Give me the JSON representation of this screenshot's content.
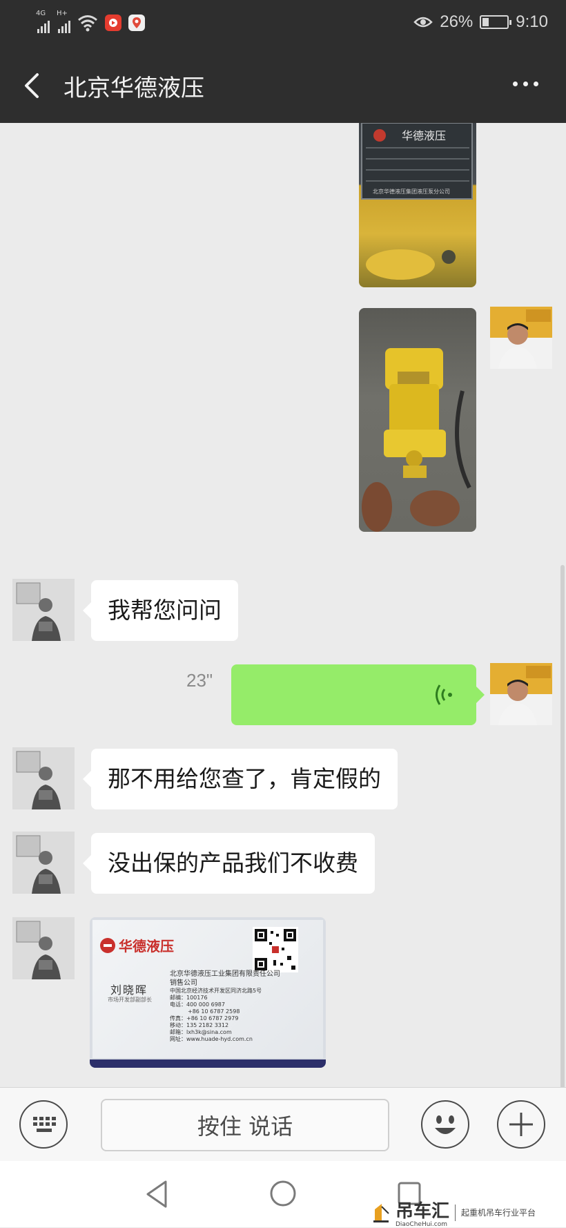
{
  "status_bar": {
    "network_1": "4G",
    "network_2": "H+",
    "battery_percent": "26%",
    "battery_level": 0.26,
    "time": "9:10"
  },
  "header": {
    "title": "北京华德液压"
  },
  "messages": [
    {
      "side": "right",
      "kind": "image",
      "description": "nameplate-photo",
      "visible_text": [
        "华德液压",
        "北京华德液压集团液压泵分公司"
      ]
    },
    {
      "side": "right",
      "kind": "image",
      "description": "hydraulic-pump-photo"
    },
    {
      "side": "left",
      "kind": "text",
      "text": "我帮您问问"
    },
    {
      "side": "right",
      "kind": "voice",
      "duration": "23\""
    },
    {
      "side": "left",
      "kind": "text",
      "text": "那不用给您查了，肯定假的"
    },
    {
      "side": "left",
      "kind": "text",
      "text": "没出保的产品我们不收费"
    },
    {
      "side": "left",
      "kind": "image",
      "description": "business-card-photo"
    }
  ],
  "business_card": {
    "brand": "华德液压",
    "name": "刘晓晖",
    "position": "市场开发部副部长",
    "company": "北京华德液压工业集团有限责任公司",
    "division": "销售公司",
    "address": "中国北京经济技术开发区同济北路5号",
    "postcode": "邮编：100176",
    "phone": "电话：400 000 6987",
    "phone2": "+86 10 6787 2598",
    "fax": "传真：+86 10 6787 2979",
    "mobile": "移动：135 2182 3312",
    "email": "邮箱：lxh3k@sina.com",
    "website": "网址：www.huade-hyd.com.cn"
  },
  "nameplate": {
    "brand": "华德液压",
    "maker": "北京华德液压集团液压泵分公司"
  },
  "input_bar": {
    "hold_to_talk": "按住 说话"
  },
  "watermark": {
    "name": "吊车汇",
    "url": "DiaoCheHui.com",
    "tagline": "起重机吊车行业平台"
  },
  "colors": {
    "header_bg": "#2e2e2e",
    "chat_bg": "#ebebeb",
    "bubble_sent": "#95ec69",
    "bubble_received": "#ffffff"
  }
}
